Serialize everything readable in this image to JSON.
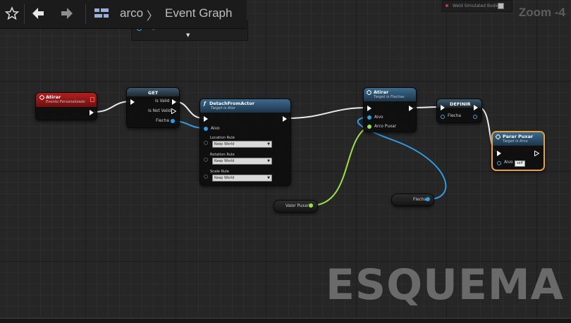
{
  "toolbar": {
    "breadcrumb_asset": "arco",
    "breadcrumb_separator": "〉",
    "breadcrumb_graph": "Event Graph",
    "dropdown_item": "Instigator"
  },
  "details_strip": {
    "weld_label": "Weld Simulated Bodies"
  },
  "zoom_label": "Zoom -4",
  "watermark": "ESQUEMA",
  "colors": {
    "event_header": "#a01a1a",
    "function_header": "#2a4f6b",
    "object_pin": "#2f9ce0",
    "float_pin": "#9be04a",
    "selection_border": "#e8a03a"
  },
  "nodes": {
    "event_atirar": {
      "title": "Atirar",
      "subtitle": "Evento Personalizado"
    },
    "get": {
      "title": "GET",
      "pins": {
        "is_valid": "Is Valid",
        "is_not_valid": "Is Not Valid",
        "flecha": "Flecha"
      }
    },
    "detach": {
      "title": "DetachFromActor",
      "subtitle": "Target is Ator",
      "pins": {
        "alvo": "Alvo",
        "location_rule": "Location Rule",
        "rotation_rule": "Rotation Rule",
        "scale_rule": "Scale Rule"
      },
      "values": {
        "location_rule": "Keep World",
        "rotation_rule": "Keep World",
        "scale_rule": "Keep World"
      }
    },
    "call_atirar": {
      "title": "Atirar",
      "subtitle": "Target is Flechas",
      "pins": {
        "alvo": "Alvo",
        "arco_puxar": "Arco Puxar"
      }
    },
    "definir": {
      "title": "DEFINIR",
      "pins": {
        "flecha": "Flecha"
      }
    },
    "parar_puxar": {
      "title": "Parar Puxar",
      "subtitle": "Target is Arco",
      "pins": {
        "alvo": "Alvo"
      },
      "values": {
        "alvo": "self"
      }
    },
    "valor_puxar": {
      "label": "Valor Puxar"
    },
    "flecha_var": {
      "label": "Flecha"
    }
  }
}
